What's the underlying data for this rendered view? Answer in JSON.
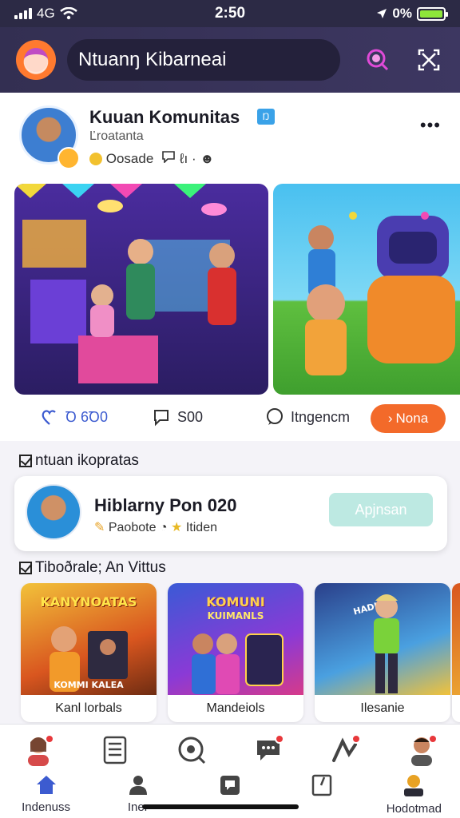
{
  "status_bar": {
    "carrier": "4G",
    "time": "2:50",
    "battery_pct": "0%",
    "battery_level": 1.0
  },
  "header": {
    "search_text": "Ntuanŋ Kibarneai",
    "logo_icon": "app-logo",
    "search_icon": "search-icon",
    "fullscreen_icon": "expand-icon"
  },
  "profile": {
    "name": "Kuuan Komunitas",
    "verified_mark": "Ŋ",
    "subtitle": "Ľroatanta",
    "coins": "Oosade",
    "count": "ℓı",
    "separator": "·"
  },
  "actions": {
    "likes": "Ꝺ 6Ꝺ0",
    "comments": "S00",
    "messages": "Itngencm",
    "primary": "Nona"
  },
  "section1": {
    "title": "ntuan ikopratas",
    "card": {
      "title": "Hiblarny Pon 020",
      "meta_left": "Paobote",
      "meta_right": "Itiden",
      "button": "Apjnsan"
    }
  },
  "section2": {
    "title": "Tiboðrale; An Vittus",
    "games": [
      {
        "label": "Kanl lorbals",
        "art_title": "KANYNOATAS",
        "art_sub": "KOMMI KALEA"
      },
      {
        "label": "Mandeiols",
        "art_title": "KOMUNI",
        "art_sub": "KUIMANLS"
      },
      {
        "label": "Ilesanie",
        "art_title": "HADIDI",
        "art_sub": ""
      }
    ]
  },
  "bottom_nav": {
    "items": [
      {
        "label": "Indenuss",
        "icon": "home-icon"
      },
      {
        "label": "Iner",
        "icon": "person-icon"
      },
      {
        "label": "",
        "icon": "chat-square-icon"
      },
      {
        "label": "",
        "icon": "book-icon"
      },
      {
        "label": "Hodotmad",
        "icon": "profile-icon"
      }
    ]
  },
  "colors": {
    "accent": "#f36a2a",
    "header": "#332f52",
    "verified": "#3aa2e8",
    "button_disabled": "#bde9e2"
  }
}
